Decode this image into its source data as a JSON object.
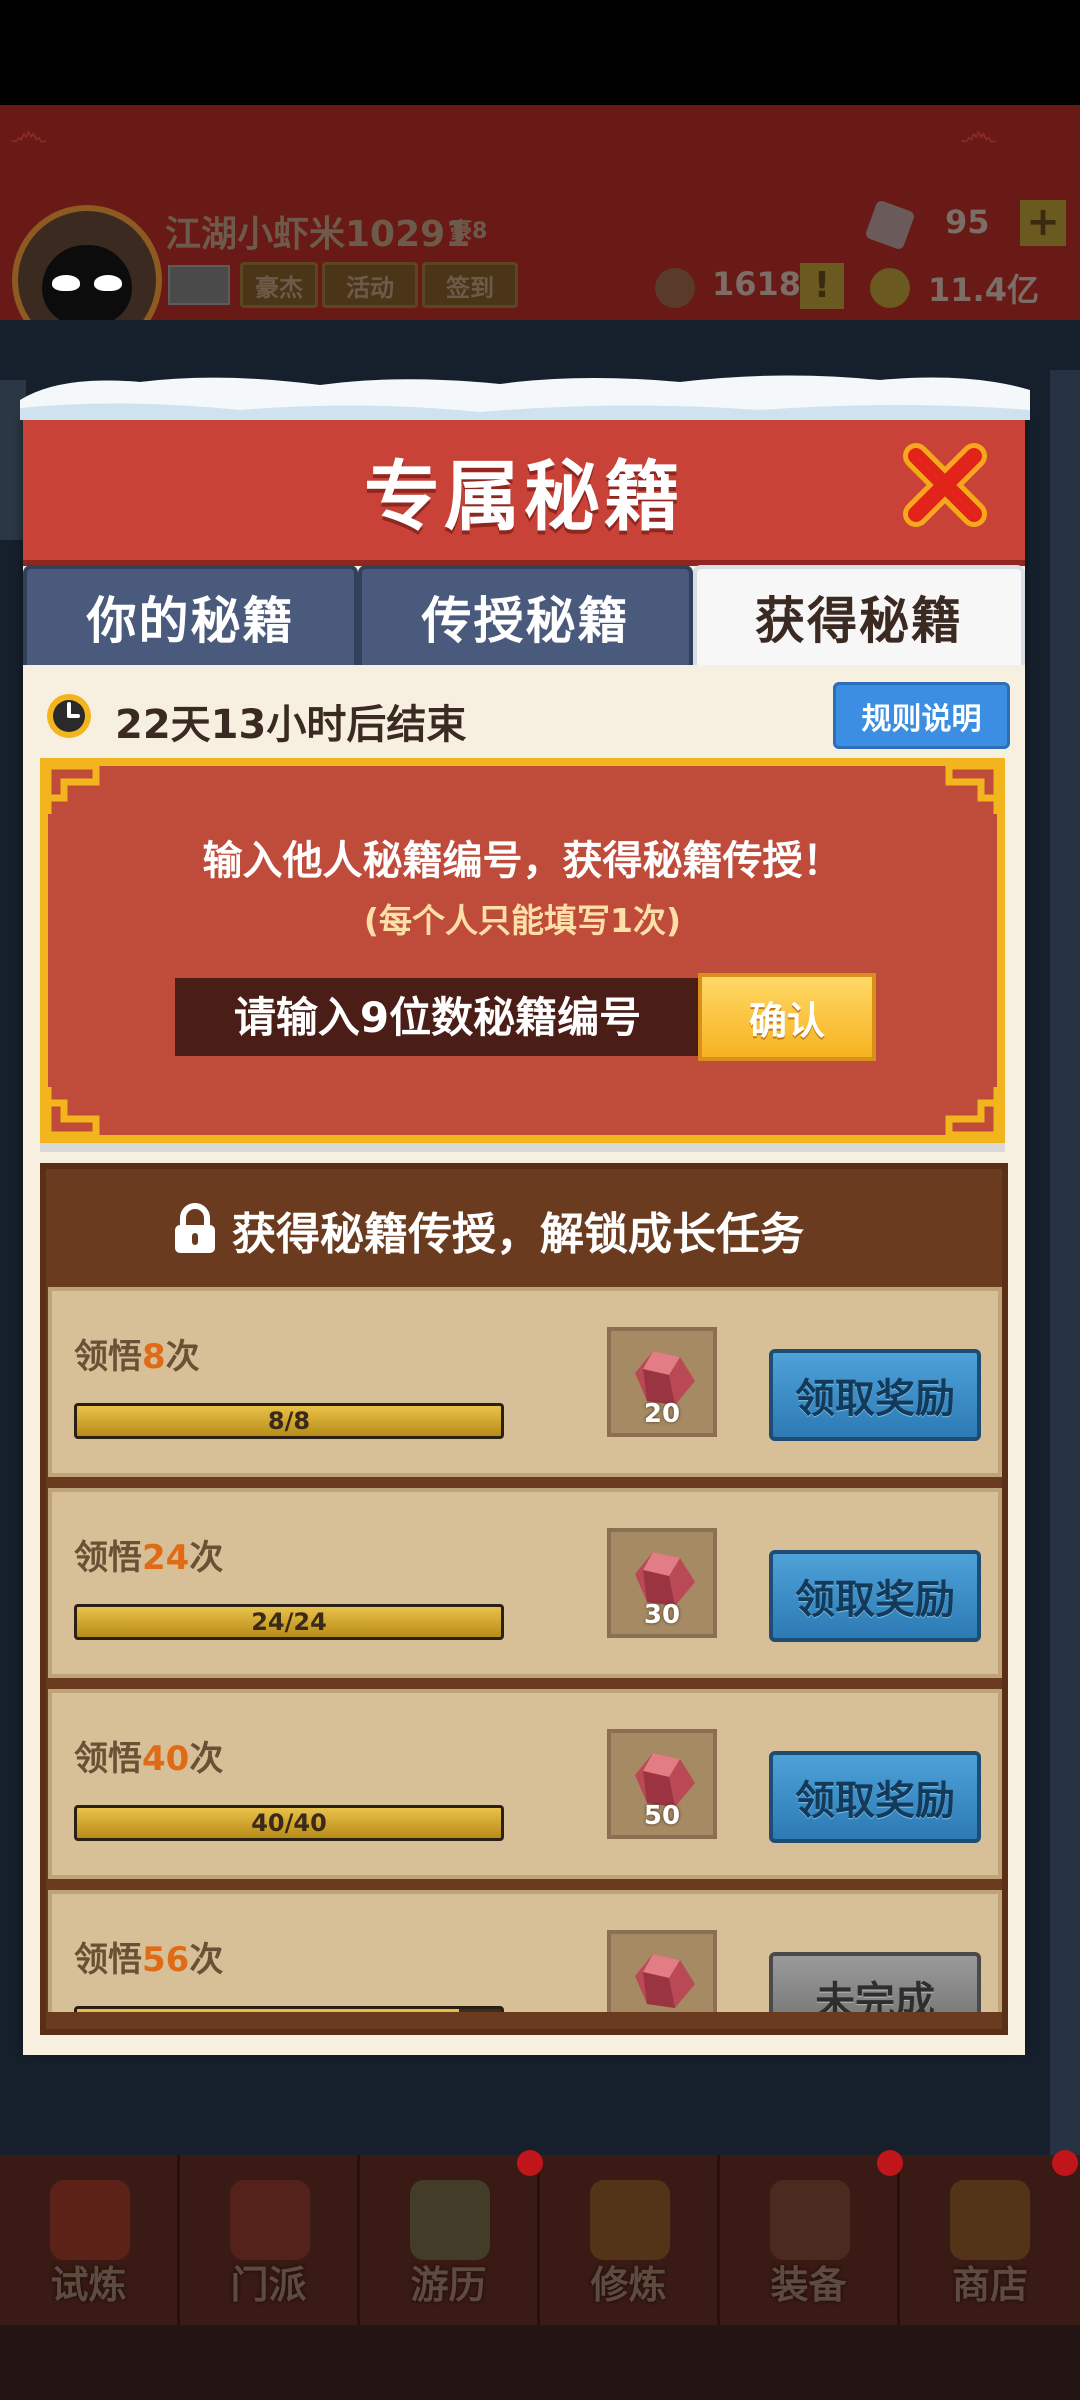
{
  "header": {
    "player_name": "江湖小虾米10291",
    "player_badge": "豪8",
    "buttons": [
      {
        "label": "豪杰"
      },
      {
        "label": "活动"
      },
      {
        "label": "签到"
      }
    ],
    "gems": "95",
    "tickets": "1618",
    "alert": "!",
    "coins": "11.4亿",
    "plus": "+"
  },
  "modal": {
    "title": "专属秘籍",
    "tabs": [
      {
        "label": "你的秘籍",
        "active": false
      },
      {
        "label": "传授秘籍",
        "active": false
      },
      {
        "label": "获得秘籍",
        "active": true
      }
    ],
    "timer": "22天13小时后结束",
    "rules_button": "规则说明",
    "code_panel": {
      "title": "输入他人秘籍编号，获得秘籍传授！",
      "subtitle": "(每个人只能填写1次)",
      "input_placeholder": "请输入9位数秘籍编号",
      "input_value": "",
      "confirm": "确认"
    },
    "tasks_header": "获得秘籍传授，解锁成长任务",
    "tasks": [
      {
        "prefix": "领悟",
        "count": "8",
        "suffix": "次",
        "progress_text": "8/8",
        "progress": 1.0,
        "reward": "20",
        "button": "领取奖励",
        "completed": true
      },
      {
        "prefix": "领悟",
        "count": "24",
        "suffix": "次",
        "progress_text": "24/24",
        "progress": 1.0,
        "reward": "30",
        "button": "领取奖励",
        "completed": true
      },
      {
        "prefix": "领悟",
        "count": "40",
        "suffix": "次",
        "progress_text": "40/40",
        "progress": 1.0,
        "reward": "50",
        "button": "领取奖励",
        "completed": true
      },
      {
        "prefix": "领悟",
        "count": "56",
        "suffix": "次",
        "progress_text": "",
        "progress": 0.9,
        "reward": "",
        "button": "未完成",
        "completed": false
      }
    ]
  },
  "bottom_nav": [
    {
      "label": "试炼"
    },
    {
      "label": "门派"
    },
    {
      "label": "游历"
    },
    {
      "label": "修炼"
    },
    {
      "label": "装备"
    },
    {
      "label": "商店"
    }
  ],
  "colors": {
    "banner_red": "#c84238",
    "panel_gold": "#f2b51d",
    "claim_blue": "#3b8ee2",
    "highlight_orange": "#e06b17"
  }
}
